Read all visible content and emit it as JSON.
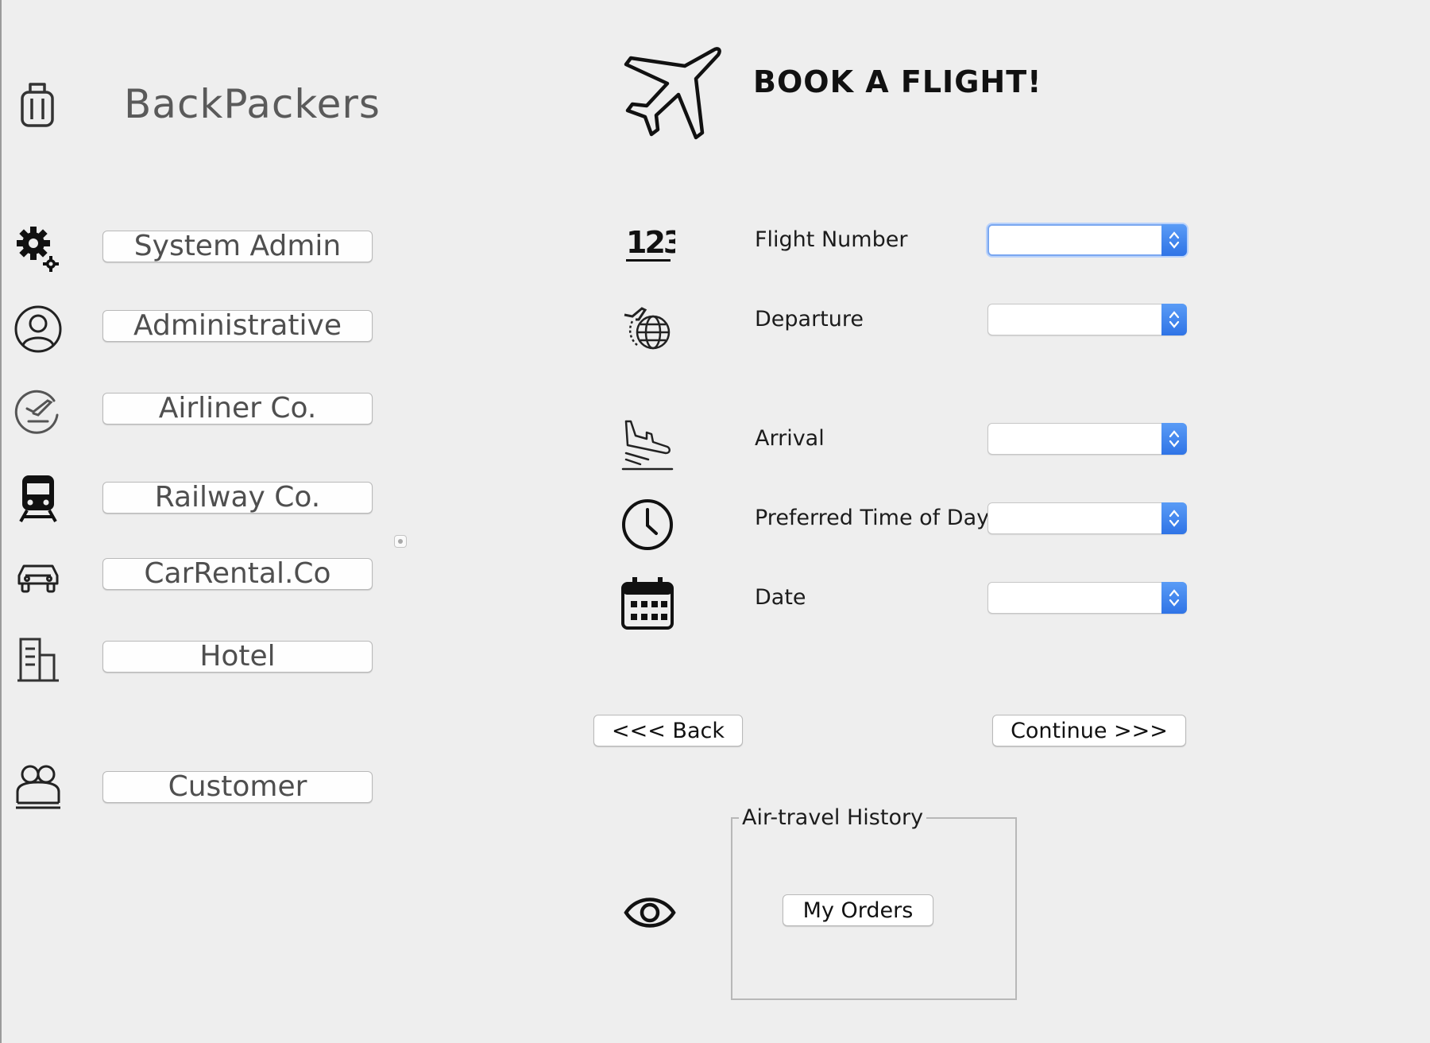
{
  "brand": {
    "title": "BackPackers",
    "icon": "luggage-icon"
  },
  "sidebar": {
    "items": [
      {
        "label": "System Admin",
        "icon": "gears-icon"
      },
      {
        "label": "Administrative",
        "icon": "user-circle-icon"
      },
      {
        "label": "Airliner Co.",
        "icon": "airline-badge-icon"
      },
      {
        "label": "Railway Co.",
        "icon": "train-icon"
      },
      {
        "label": "CarRental.Co",
        "icon": "car-icon"
      },
      {
        "label": "Hotel",
        "icon": "building-icon"
      },
      {
        "label": "Customer",
        "icon": "users-icon"
      }
    ]
  },
  "header": {
    "title": "BOOK A FLIGHT!",
    "icon": "airplane-icon"
  },
  "form": {
    "fields": [
      {
        "label": "Flight Number",
        "value": "",
        "icon": "numbers-123-icon"
      },
      {
        "label": "Departure",
        "value": "",
        "icon": "globe-departure-icon"
      },
      {
        "label": "Arrival",
        "value": "",
        "icon": "plane-landing-icon"
      },
      {
        "label": "Preferred Time of Day",
        "value": "",
        "icon": "clock-icon"
      },
      {
        "label": "Date",
        "value": "",
        "icon": "calendar-icon"
      }
    ]
  },
  "actions": {
    "back_label": "<<< Back",
    "continue_label": "Continue >>>"
  },
  "history": {
    "legend": "Air-travel History",
    "orders_label": "My Orders",
    "icon": "eye-icon"
  },
  "colors": {
    "background": "#eeeeee",
    "select_accent": "#3b82f0",
    "focus_ring": "#7aa7f0"
  }
}
